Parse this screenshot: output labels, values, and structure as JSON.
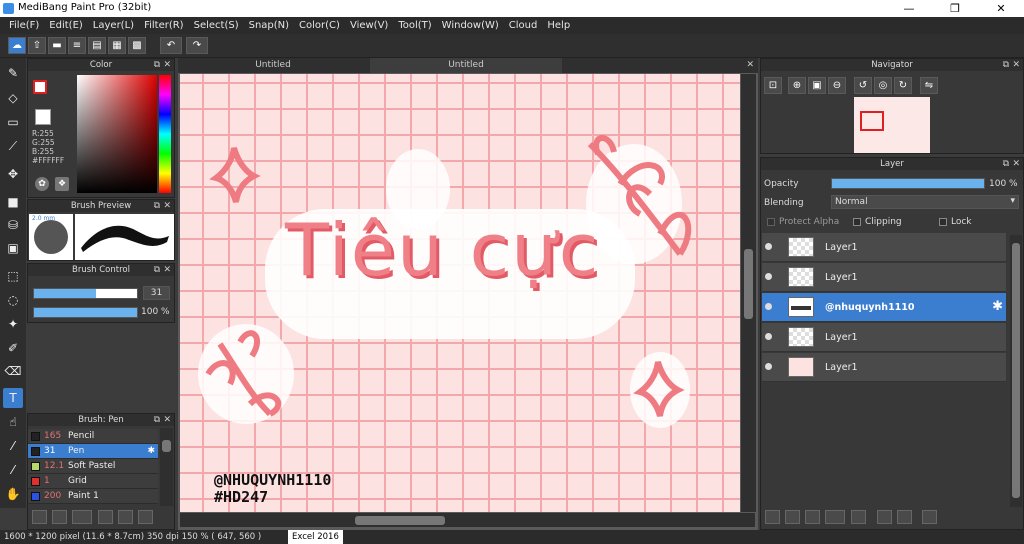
{
  "window": {
    "title": "MediBang Paint Pro (32bit)",
    "min": "—",
    "restore": "❐",
    "close": "✕"
  },
  "menu": [
    "File(F)",
    "Edit(E)",
    "Layer(L)",
    "Filter(R)",
    "Select(S)",
    "Snap(N)",
    "Color(C)",
    "View(V)",
    "Tool(T)",
    "Window(W)",
    "Cloud",
    "Help"
  ],
  "color_panel": {
    "title": "Color",
    "r": "R:255",
    "g": "G:255",
    "b": "B:255",
    "hex": "#FFFFFF"
  },
  "brush_preview": {
    "title": "Brush Preview",
    "size_label": "2.0 mm"
  },
  "brush_control": {
    "title": "Brush Control",
    "size": "31",
    "opacity": "100 %",
    "size_fraction": 0.6,
    "opacity_fraction": 1.0
  },
  "brush_list": {
    "title": "Brush: Pen",
    "items": [
      {
        "size": "165",
        "name": "Pencil",
        "color": "#222222"
      },
      {
        "size": "31",
        "name": "Pen",
        "color": "#222222"
      },
      {
        "size": "12.1",
        "name": "Soft Pastel",
        "color": "#b7d96a"
      },
      {
        "size": "1",
        "name": "Grid",
        "color": "#e03030"
      },
      {
        "size": "200",
        "name": "Paint 1",
        "color": "#2c52e0"
      }
    ]
  },
  "tabs": [
    "Untitled",
    "Untitled"
  ],
  "canvas": {
    "title_text": "Tiêu cực",
    "watermark_line1": "@NHUQUYNH1110",
    "watermark_line2": "#HD247"
  },
  "navigator": {
    "title": "Navigator"
  },
  "layer_panel": {
    "title": "Layer",
    "opacity_label": "Opacity",
    "opacity_value": "100 %",
    "blending_label": "Blending",
    "blending_value": "Normal",
    "protect_alpha": "Protect Alpha",
    "clipping": "Clipping",
    "lock": "Lock",
    "layers": [
      {
        "name": "Layer1",
        "selected": false
      },
      {
        "name": "Layer1",
        "selected": false
      },
      {
        "name": "@nhuquynh1110",
        "selected": true
      },
      {
        "name": "Layer1",
        "selected": false
      },
      {
        "name": "Layer1",
        "selected": false
      }
    ]
  },
  "status": {
    "info": "1600 * 1200 pixel   (11.6 * 8.7cm)   350 dpi   150 %   ( 647, 560 )",
    "tooltip": "Excel 2016"
  },
  "colors": {
    "accent": "#3b7ed0",
    "paper": "#fde2e2",
    "grid": "#f3a8ac",
    "text_pink": "#ef7b82"
  }
}
